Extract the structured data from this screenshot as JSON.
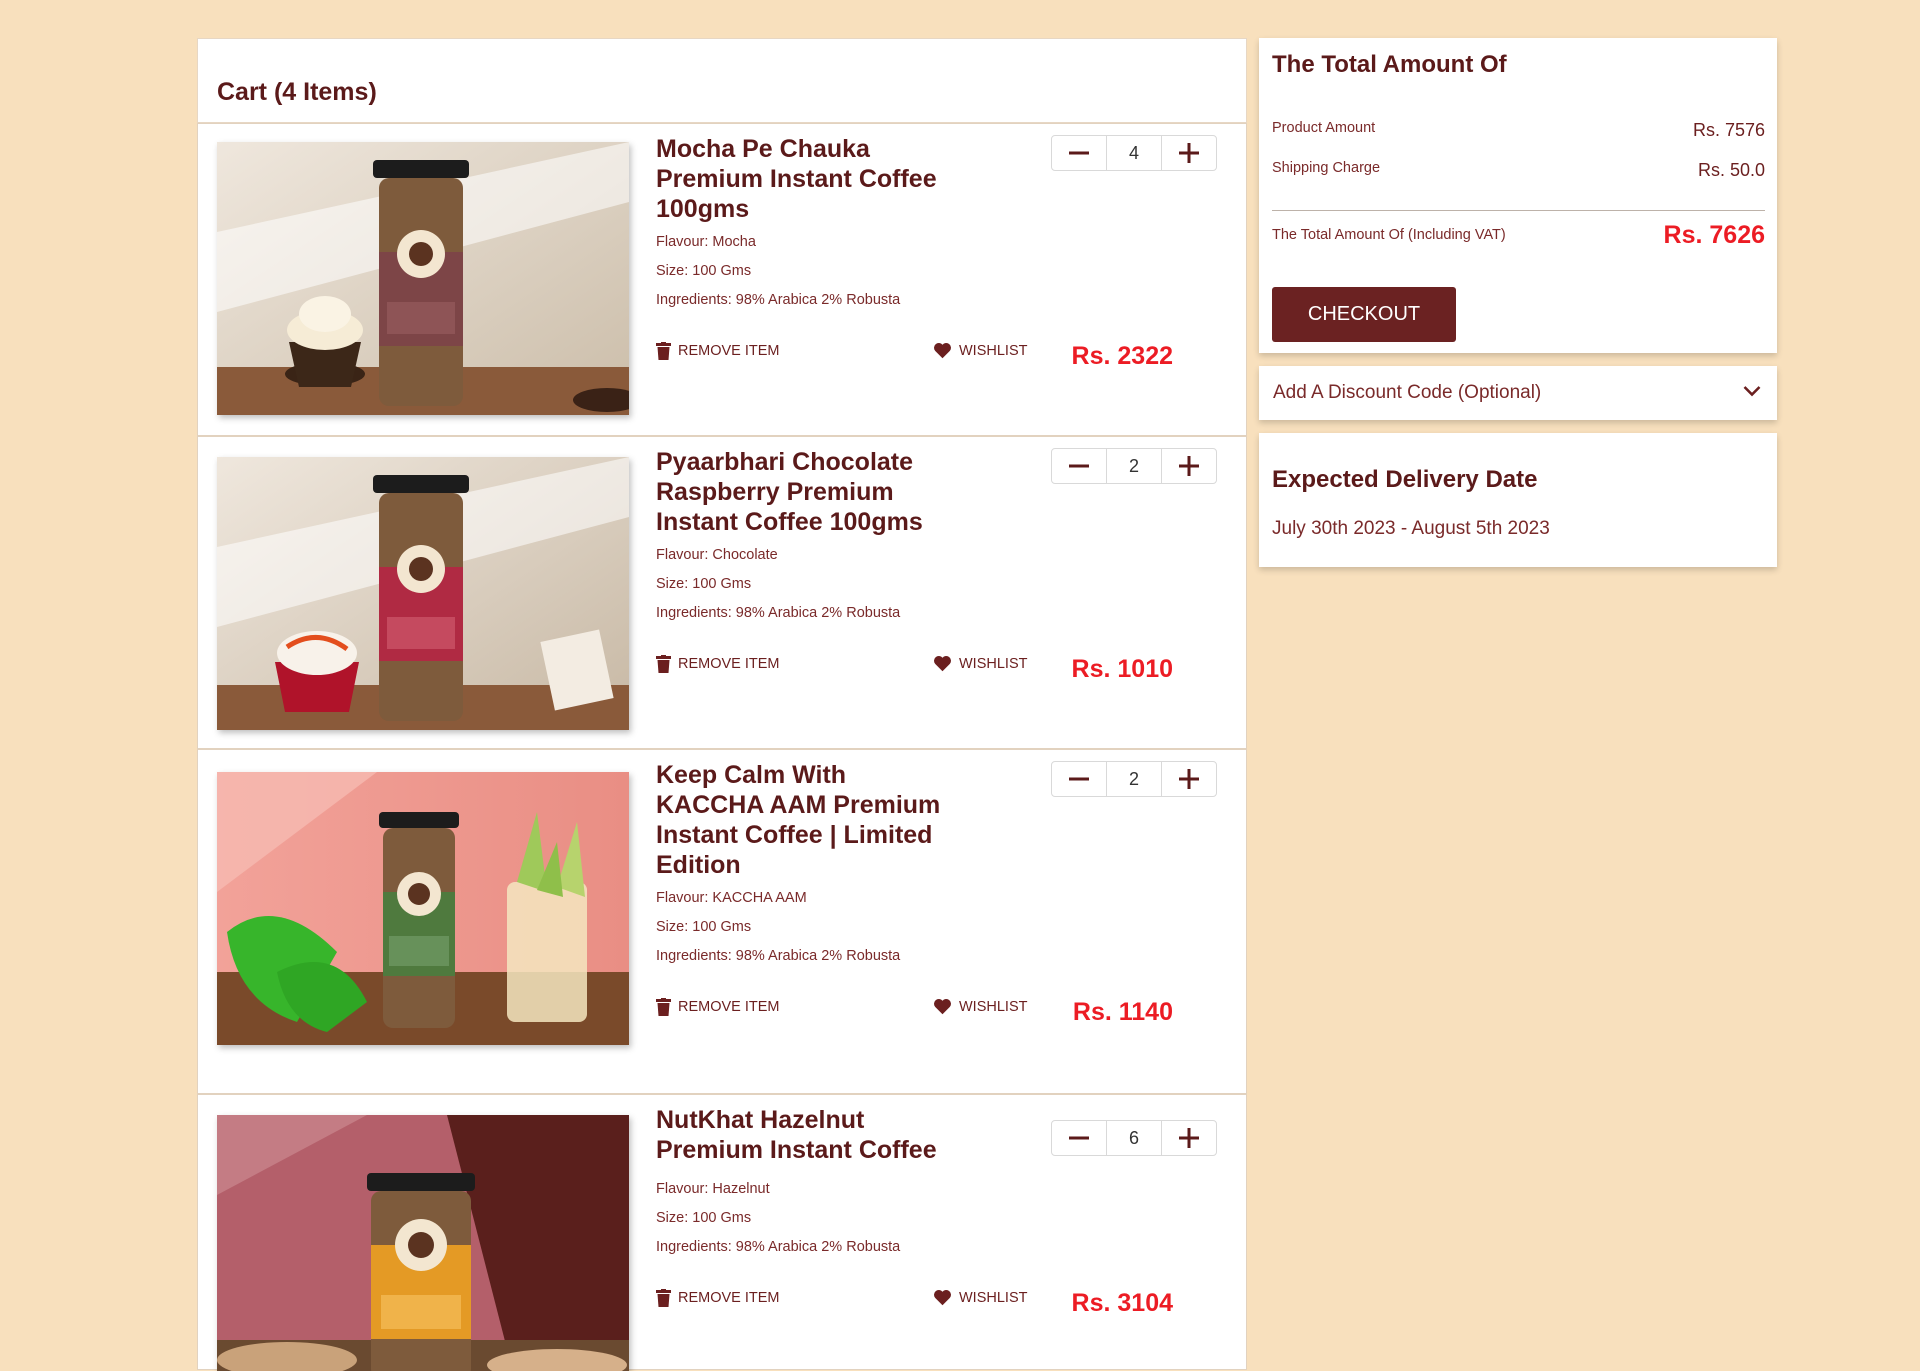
{
  "cart": {
    "title": "Cart (4 Items)",
    "remove_label": "REMOVE ITEM",
    "wishlist_label": "WISHLIST",
    "items": [
      {
        "name": "Mocha Pe Chauka Premium Instant Coffee 100gms",
        "flavour": "Flavour: Mocha",
        "size": "Size: 100 Gms",
        "ingredients": "Ingredients: 98% Arabica 2% Robusta",
        "quantity": "4",
        "price": "Rs. 2322",
        "label_color": "#7d4547"
      },
      {
        "name": "Pyaarbhari Chocolate Raspberry Premium Instant Coffee 100gms",
        "flavour": "Flavour: Chocolate",
        "size": "Size: 100 Gms",
        "ingredients": "Ingredients: 98% Arabica 2% Robusta",
        "quantity": "2",
        "price": "Rs. 1010",
        "label_color": "#b02a43"
      },
      {
        "name": "Keep Calm With KACCHA AAM Premium Instant Coffee | Limited Edition",
        "flavour": "Flavour: KACCHA AAM",
        "size": "Size: 100 Gms",
        "ingredients": "Ingredients: 98% Arabica 2% Robusta",
        "quantity": "2",
        "price": "Rs. 1140",
        "label_color": "#4f7a3e"
      },
      {
        "name": "NutKhat Hazelnut Premium Instant Coffee",
        "flavour": "Flavour: Hazelnut",
        "size": "Size: 100 Gms",
        "ingredients": "Ingredients: 98% Arabica 2% Robusta",
        "quantity": "6",
        "price": "Rs. 3104",
        "label_color": "#e49a25"
      }
    ]
  },
  "summary": {
    "title": "The Total Amount Of",
    "product_amount_label": "Product Amount",
    "product_amount": "Rs. 7576",
    "shipping_label": "Shipping Charge",
    "shipping": "Rs. 50.0",
    "total_label": "The Total Amount Of (Including VAT)",
    "total": "Rs. 7626",
    "checkout_label": "CHECKOUT"
  },
  "discount": {
    "label": "Add A Discount Code (Optional)"
  },
  "delivery": {
    "title": "Expected Delivery Date",
    "dates": "July 30th 2023 - August 5th 2023"
  },
  "colors": {
    "page_bg": "#f8e0bd",
    "brand": "#6b2222",
    "price": "#ec1c24"
  }
}
